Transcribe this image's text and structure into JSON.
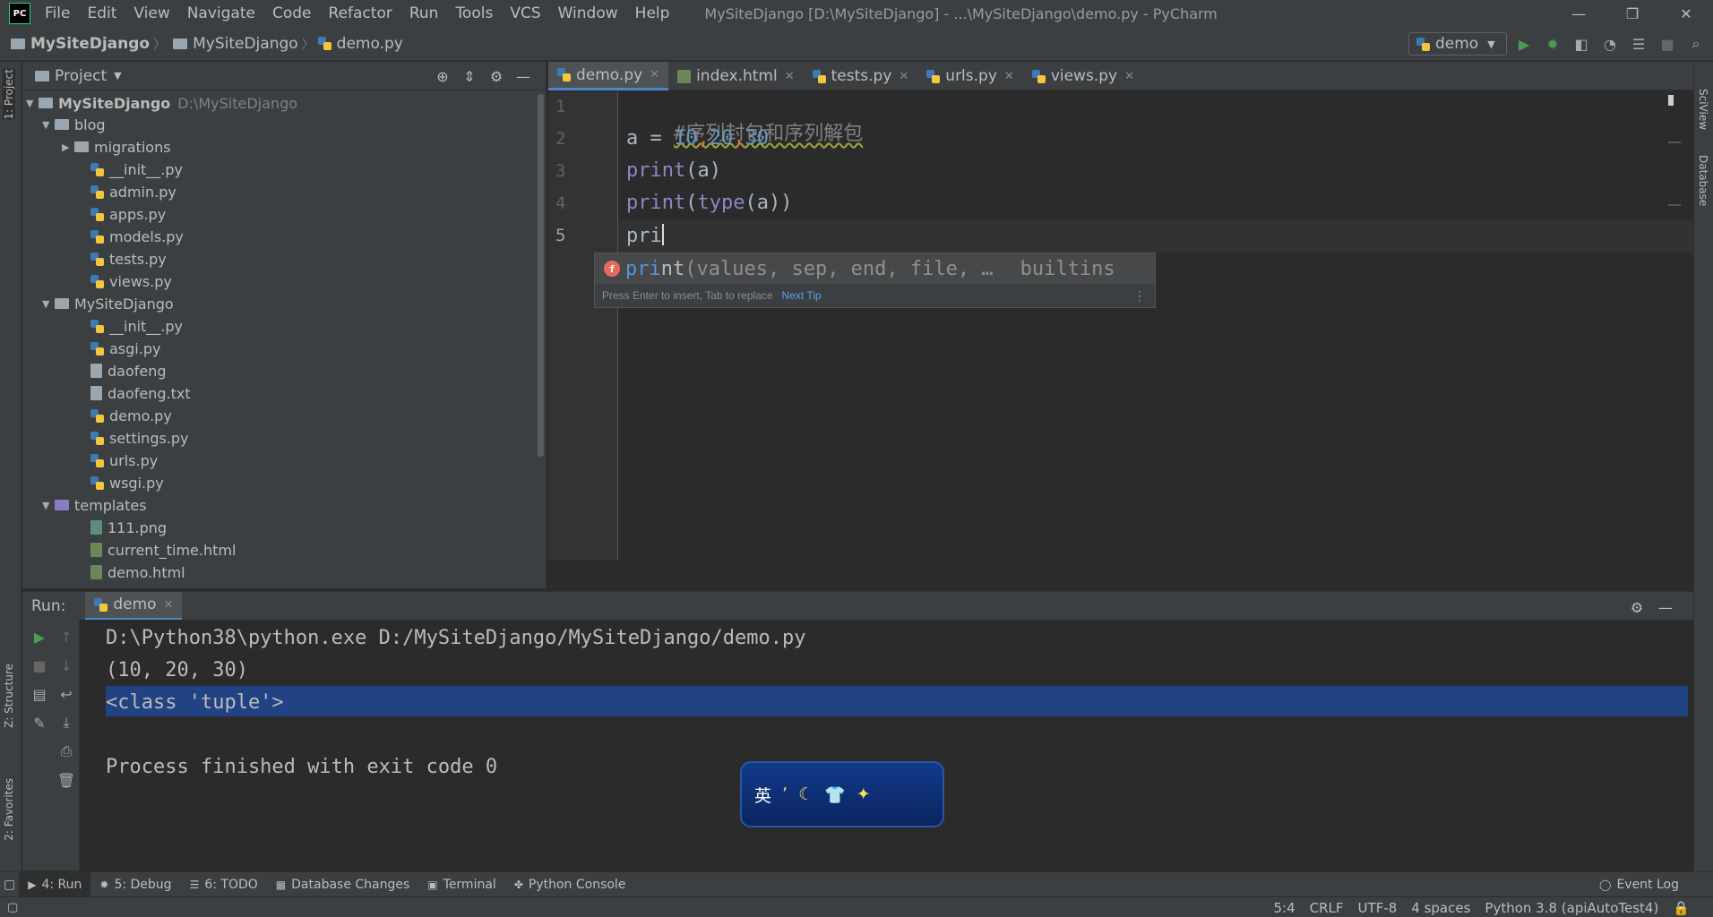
{
  "app": {
    "logo_text": "PC",
    "window_title": "MySiteDjango [D:\\MySiteDjango] - ...\\MySiteDjango\\demo.py - PyCharm",
    "menu": [
      "File",
      "Edit",
      "View",
      "Navigate",
      "Code",
      "Refactor",
      "Run",
      "Tools",
      "VCS",
      "Window",
      "Help"
    ],
    "window_controls": {
      "minimize": "—",
      "restore": "❐",
      "close": "✕"
    }
  },
  "breadcrumb": [
    "MySiteDjango",
    "MySiteDjango",
    "demo.py"
  ],
  "run_config": {
    "name": "demo"
  },
  "project_panel": {
    "title": "Project",
    "root_name": "MySiteDjango",
    "root_path": "D:\\MySiteDjango",
    "tree": [
      {
        "label": "blog",
        "kind": "folder",
        "expanded": true
      },
      {
        "label": "migrations",
        "kind": "folder",
        "expanded": false
      },
      {
        "label": "__init__.py",
        "kind": "py"
      },
      {
        "label": "admin.py",
        "kind": "py"
      },
      {
        "label": "apps.py",
        "kind": "py"
      },
      {
        "label": "models.py",
        "kind": "py"
      },
      {
        "label": "tests.py",
        "kind": "py"
      },
      {
        "label": "views.py",
        "kind": "py"
      },
      {
        "label": "MySiteDjango",
        "kind": "folder",
        "expanded": true
      },
      {
        "label": "__init__.py",
        "kind": "py"
      },
      {
        "label": "asgi.py",
        "kind": "py"
      },
      {
        "label": "daofeng",
        "kind": "file"
      },
      {
        "label": "daofeng.txt",
        "kind": "file"
      },
      {
        "label": "demo.py",
        "kind": "py"
      },
      {
        "label": "settings.py",
        "kind": "py"
      },
      {
        "label": "urls.py",
        "kind": "py"
      },
      {
        "label": "wsgi.py",
        "kind": "py"
      },
      {
        "label": "templates",
        "kind": "folder",
        "expanded": true
      },
      {
        "label": "111.png",
        "kind": "png"
      },
      {
        "label": "current_time.html",
        "kind": "html"
      },
      {
        "label": "demo.html",
        "kind": "html"
      }
    ]
  },
  "editor_tabs": [
    {
      "label": "demo.py",
      "active": true
    },
    {
      "label": "index.html",
      "active": false
    },
    {
      "label": "tests.py",
      "active": false
    },
    {
      "label": "urls.py",
      "active": false
    },
    {
      "label": "views.py",
      "active": false
    }
  ],
  "editor": {
    "line_numbers": [
      "1",
      "2",
      "3",
      "4",
      "5"
    ],
    "lines": {
      "l1_comment": "#序列封包和序列解包",
      "l2": {
        "var": "a = ",
        "n1": "10",
        "c1": ",",
        "n2": "20",
        "c2": ",",
        "n3": "30"
      },
      "l3": {
        "fn": "print",
        "rest": "(a)"
      },
      "l4": {
        "fn": "print",
        "mid": "(",
        "fn2": "type",
        "rest": "(a))"
      },
      "l5": "pri"
    },
    "cursor": "5:4"
  },
  "completion": {
    "icon": "f",
    "match": "pri",
    "rest": "nt",
    "params": "(values, sep, end, file, …",
    "source": "builtins",
    "hint": "Press Enter to insert, Tab to replace",
    "next_tip": "Next Tip"
  },
  "run_panel": {
    "label": "Run:",
    "tab": "demo",
    "output": [
      "D:\\Python38\\python.exe D:/MySiteDjango/MySiteDjango/demo.py",
      "(10, 20, 30)",
      "<class 'tuple'>",
      "",
      "Process finished with exit code 0"
    ]
  },
  "ime_widget": {
    "char": "英"
  },
  "side_stripes": {
    "left": [
      "1: Project",
      "Z: Structure",
      "2: Favorites"
    ],
    "right": [
      "SciView",
      "Database"
    ]
  },
  "bottom_tools": [
    {
      "label": "4: Run",
      "active": true
    },
    {
      "label": "5: Debug",
      "active": false
    },
    {
      "label": "6: TODO",
      "active": false
    },
    {
      "label": "Database Changes",
      "active": false
    },
    {
      "label": "Terminal",
      "active": false
    },
    {
      "label": "Python Console",
      "active": false
    }
  ],
  "event_log": "Event Log",
  "status": {
    "position": "5:4",
    "line_sep": "CRLF",
    "encoding": "UTF-8",
    "indent": "4 spaces",
    "interpreter": "Python 3.8 (apiAutoTest4)"
  },
  "colors": {
    "background": "#2b2b2b",
    "panel": "#3c3f41",
    "accent": "#4a88c7",
    "selection": "#214283",
    "run_green": "#499c54"
  }
}
